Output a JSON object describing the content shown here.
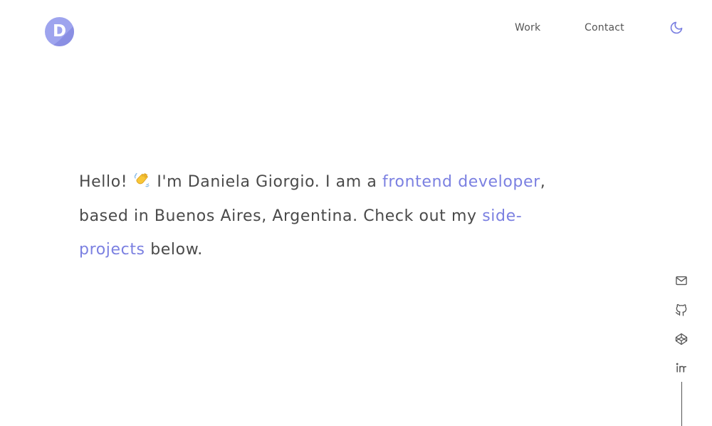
{
  "header": {
    "logo_letter": "D",
    "nav": [
      {
        "label": "Work"
      },
      {
        "label": "Contact"
      }
    ],
    "theme_icon": "moon-icon"
  },
  "intro": {
    "greeting": "Hello!",
    "emoji": "waving-hand",
    "text_1": " I'm Daniela Giorgio. I am a ",
    "link_role": "frontend developer",
    "text_2": ", based in Buenos Aires, Argentina. Check out my ",
    "link_projects": "side-projects",
    "text_3": " below."
  },
  "social": [
    "mail-icon",
    "github-icon",
    "codepen-icon",
    "linkedin-icon"
  ],
  "colors": {
    "accent": "#7b80e1",
    "logo_bg": "#9ea4ee",
    "text": "#4a4a4a"
  }
}
